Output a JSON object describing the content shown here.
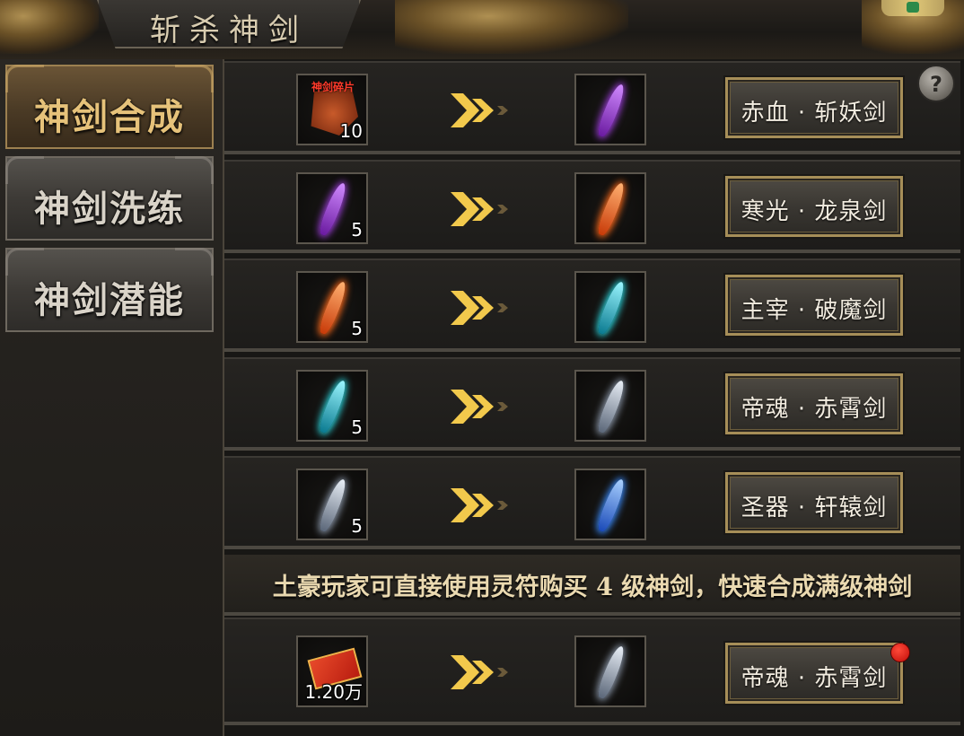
{
  "title": "斩杀神剑",
  "help_icon": "question-mark-icon",
  "help_text": "?",
  "sidebar": {
    "tabs": [
      {
        "label": "神剑合成",
        "active": true
      },
      {
        "label": "神剑洗练",
        "active": false
      },
      {
        "label": "神剑潜能",
        "active": false
      }
    ]
  },
  "rows": [
    {
      "source_icon": "sword-fragment-icon",
      "source_icon_text": "神剑碎片",
      "source_count": "10",
      "target_icon": "purple-sword-icon",
      "action_label": "赤血 · 斩妖剑"
    },
    {
      "source_icon": "purple-sword-icon",
      "source_count": "5",
      "target_icon": "orange-sword-icon",
      "action_label": "寒光 · 龙泉剑"
    },
    {
      "source_icon": "orange-sword-icon",
      "source_count": "5",
      "target_icon": "cyan-sword-icon",
      "action_label": "主宰 · 破魔剑"
    },
    {
      "source_icon": "cyan-sword-icon",
      "source_count": "5",
      "target_icon": "silver-sword-icon",
      "action_label": "帝魂 · 赤霄剑"
    },
    {
      "source_icon": "silver-sword-icon",
      "source_count": "5",
      "target_icon": "blue-sword-icon",
      "action_label": "圣器 · 轩辕剑"
    }
  ],
  "banner": "土豪玩家可直接使用灵符购买 4 级神剑，快速合成满级神剑",
  "purchase_row": {
    "source_icon": "lingfu-icon",
    "source_count": "1.20万",
    "target_icon": "silver-sword-icon",
    "action_label": "帝魂 · 赤霄剑",
    "notification": true
  },
  "colors": {
    "accent_gold": "#e6c27a",
    "arrow_gold": "#f2c94c",
    "notification_red": "#e01010",
    "sword_purple": "#9b3cd8",
    "sword_orange": "#ff6a1a",
    "sword_cyan": "#2ad8e0",
    "sword_silver": "#b8c4d4",
    "sword_blue": "#3a8cff"
  }
}
